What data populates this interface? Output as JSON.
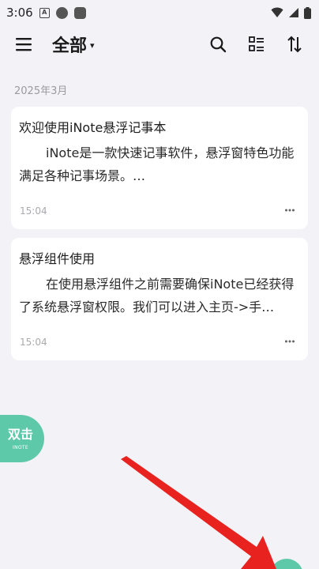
{
  "status_bar": {
    "time": "3:06",
    "app_icon_letter": "A"
  },
  "toolbar": {
    "title": "全部",
    "caret": "▾"
  },
  "group": {
    "header": "2025年3月"
  },
  "notes": [
    {
      "title": "欢迎使用iNote悬浮记事本",
      "body": "iNote是一款快速记事软件，悬浮窗特色功能满足各种记事场景。…",
      "time": "15:04"
    },
    {
      "title": "悬浮组件使用",
      "body": "在使用悬浮组件之前需要确保iNote已经获得了系统悬浮窗权限。我们可以进入主页->手…",
      "time": "15:04"
    }
  ],
  "float_bubble": {
    "label": "双击",
    "sub_label": "INOTE"
  },
  "colors": {
    "accent": "#5ec9a8",
    "background": "#f3f2f7",
    "card": "#ffffff",
    "arrow": "#e8231f"
  },
  "icons": {
    "menu": "hamburger-icon",
    "search": "search-icon",
    "layout": "list-layout-icon",
    "sort": "sort-icon",
    "more": "more-dots-icon"
  }
}
